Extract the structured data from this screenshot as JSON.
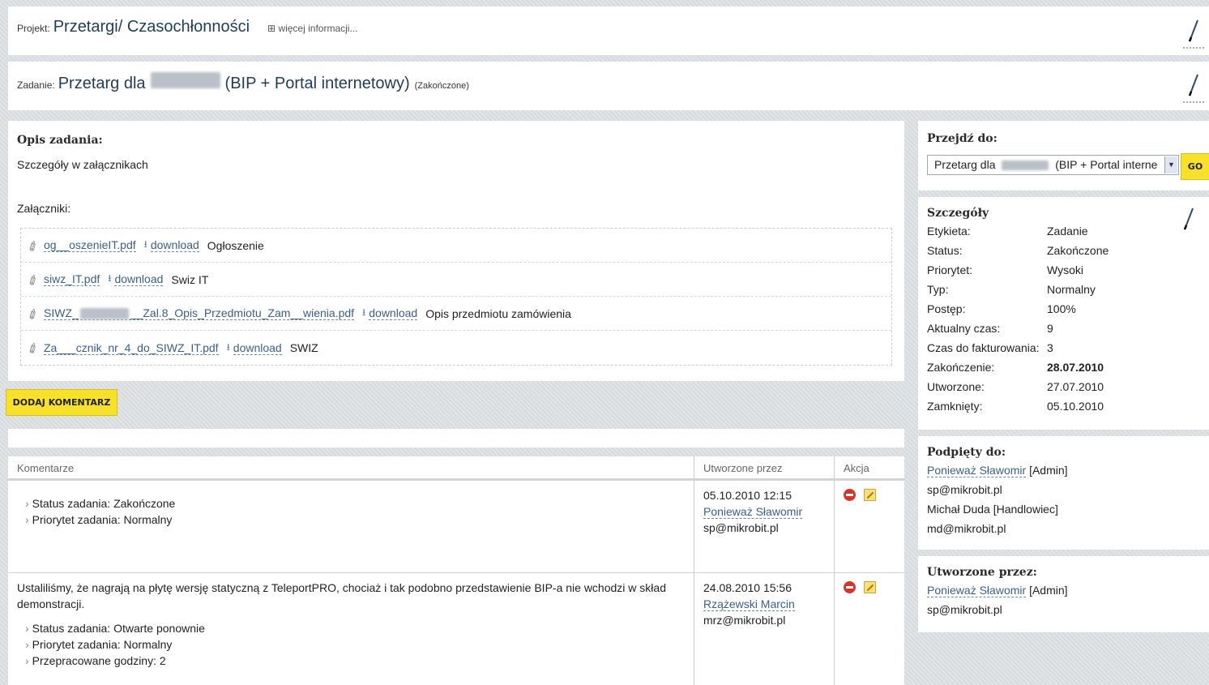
{
  "project": {
    "label": "Projekt:",
    "title": "Przetargi/ Czasochłonności",
    "more": "⊞ więcej informacji..."
  },
  "task": {
    "label": "Zadanie:",
    "title_prefix": "Przetarg dla",
    "title_suffix": "(BIP + Portal internetowy)",
    "status": "(Zakończone)"
  },
  "description": {
    "heading": "Opis zadania:",
    "text": "Szczegóły w załącznikach",
    "attachments_label": "Załączniki:",
    "download_label": "download",
    "attachments": [
      {
        "file": "og__oszenieIT.pdf",
        "desc": "Ogłoszenie"
      },
      {
        "file": "siwz_IT.pdf",
        "desc": "Swiz IT"
      },
      {
        "file_a": "SIWZ_",
        "file_b": "__Zal.8_Opis_Przedmiotu_Zam__wienia.pdf",
        "desc": "Opis przedmiotu zamówienia"
      },
      {
        "file": "Za___cznik_nr_4_do_SIWZ_IT.pdf",
        "desc": "SWIZ"
      }
    ]
  },
  "add_comment_button": "DODAJ KOMENTARZ",
  "comments": {
    "headers": [
      "Komentarze",
      "Utworzone przez",
      "Akcja"
    ],
    "rows": [
      {
        "text": "",
        "bullets": [
          "Status zadania: Zakończone",
          "Priorytet zadania: Normalny"
        ],
        "date": "05.10.2010 12:15",
        "author": "Ponieważ Sławomir",
        "email": "sp@mikrobit.pl"
      },
      {
        "text": "Ustaliliśmy, że nagrają na płytę wersję statyczną z TeleportPRO, chociaż i tak podobno przedstawienie BIP-a nie wchodzi w skład demonstracji.",
        "bullets": [
          "Status zadania: Otwarte ponownie",
          "Priorytet zadania: Normalny",
          "Przepracowane godziny: 2"
        ],
        "date": "24.08.2010 15:56",
        "author": "Rzążewski Marcin",
        "email": "mrz@mikrobit.pl"
      }
    ]
  },
  "goto": {
    "heading": "Przejdź do:",
    "select_prefix": "Przetarg dla",
    "select_suffix": "(BIP + Portal interne",
    "go_label": "GO"
  },
  "details": {
    "heading": "Szczegóły",
    "items": [
      {
        "key": "Etykieta:",
        "value": "Zadanie"
      },
      {
        "key": "Status:",
        "value": "Zakończone"
      },
      {
        "key": "Priorytet:",
        "value": "Wysoki"
      },
      {
        "key": "Typ:",
        "value": "Normalny"
      },
      {
        "key": "Postęp:",
        "value": "100%"
      },
      {
        "key": "Aktualny czas:",
        "value": "9"
      },
      {
        "key": "Czas do fakturowania:",
        "value": "3"
      },
      {
        "key": "Zakończenie:",
        "value": "28.07.2010"
      },
      {
        "key": "Utworzone:",
        "value": "27.07.2010"
      },
      {
        "key": "Zamknięty:",
        "value": "05.10.2010"
      }
    ]
  },
  "assigned": {
    "heading": "Podpięty do:",
    "person1_name": "Ponieważ Sławomir",
    "person1_role": "[Admin]",
    "person1_email": "sp@mikrobit.pl",
    "person2": "Michał Duda [Handlowiec]",
    "person2_email": "md@mikrobit.pl"
  },
  "creator": {
    "heading": "Utworzone przez:",
    "name": "Ponieważ Sławomir",
    "role": "[Admin]",
    "email": "sp@mikrobit.pl"
  },
  "icons": {
    "edit": "pencil-icon",
    "attachment": "paperclip-icon",
    "download": "download-icon",
    "delete": "delete-icon",
    "edit_comment": "edit-icon"
  },
  "colors": {
    "go_button": "#f7e12a",
    "link": "#3a5f8a",
    "title": "#1f3c5a"
  }
}
